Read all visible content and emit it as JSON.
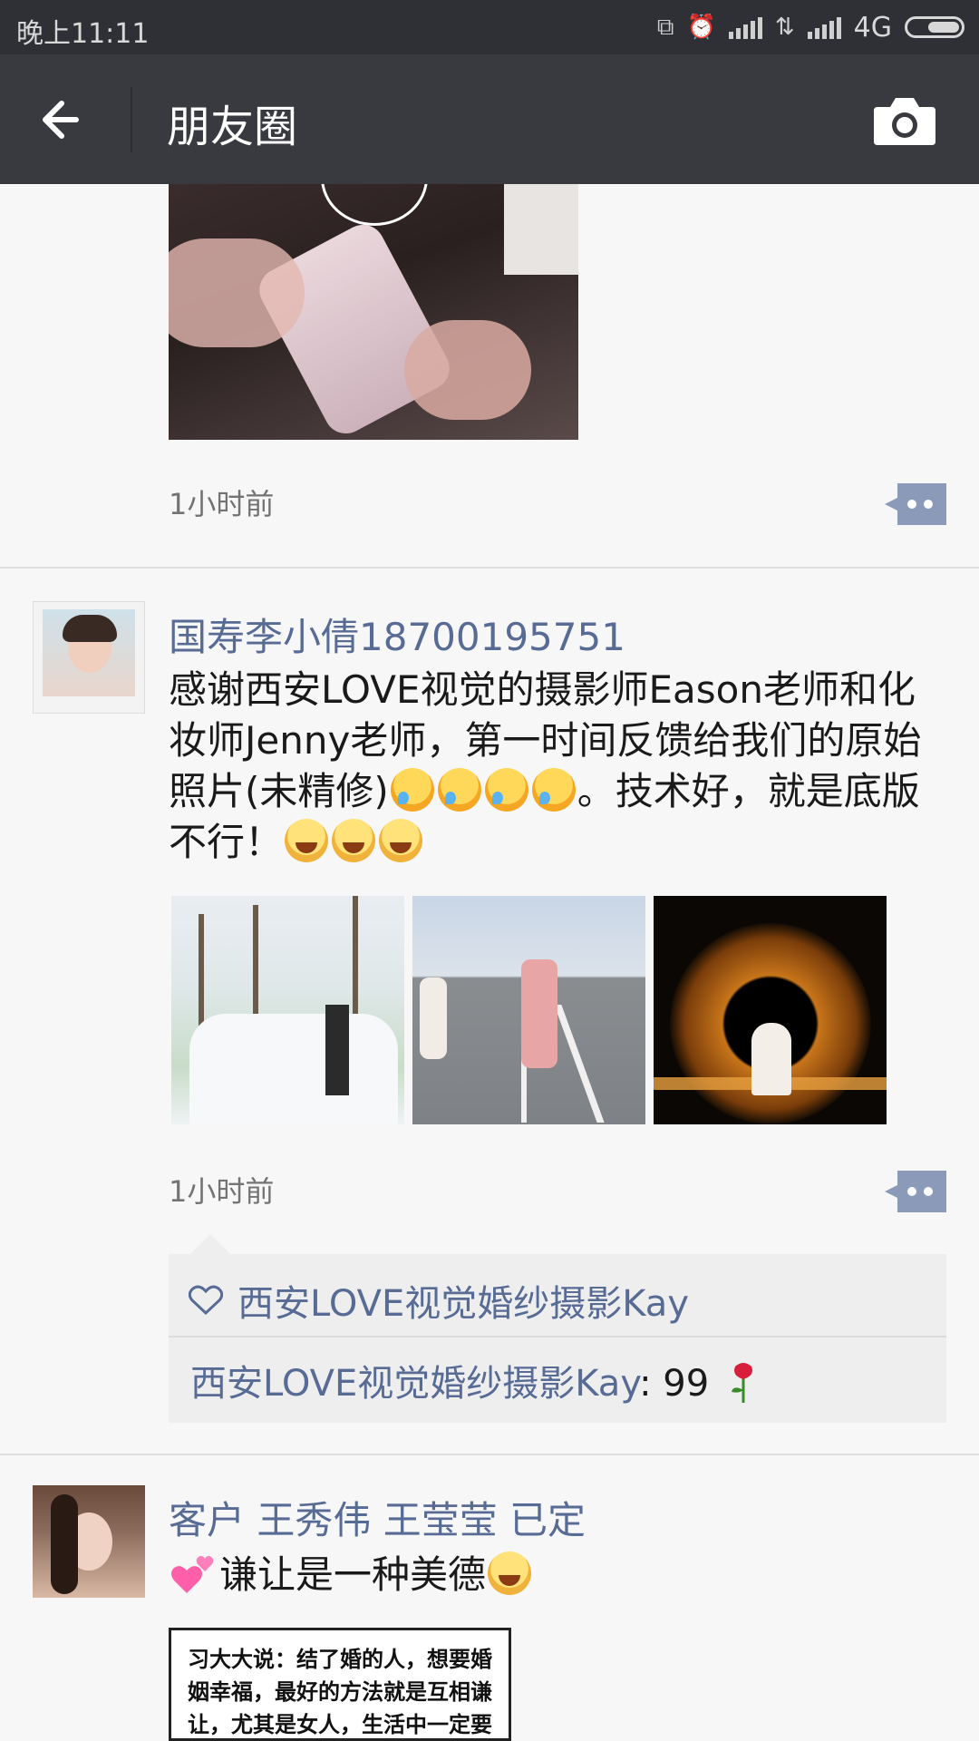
{
  "status_bar": {
    "time": "晚上11:11",
    "network": "4G"
  },
  "nav": {
    "title": "朋友圈"
  },
  "posts": [
    {
      "time": "1小时前"
    },
    {
      "author": "国寿李小倩18700195751",
      "text": "感谢西安LOVE视觉的摄影师Eason老师和化妆师Jenny老师，第一时间反馈给我们的原始照片(未精修)",
      "text_after": "。技术好，就是底版不行！",
      "time": "1小时前",
      "likes": {
        "users": "西安LOVE视觉婚纱摄影Kay"
      },
      "comments": [
        {
          "author": "西安LOVE视觉婚纱摄影Kay",
          "separator": ": ",
          "text": "99"
        }
      ]
    },
    {
      "author": "客户 王秀伟 王莹莹 已定",
      "text": "谦让是一种美德",
      "image_text": "习大大说：结了婚的人，想要婚姻幸福，最好的方法就是互相谦让，尤其是女人，生活中一定要处处让着老公！让他做饭，让他洗衣，让"
    }
  ]
}
